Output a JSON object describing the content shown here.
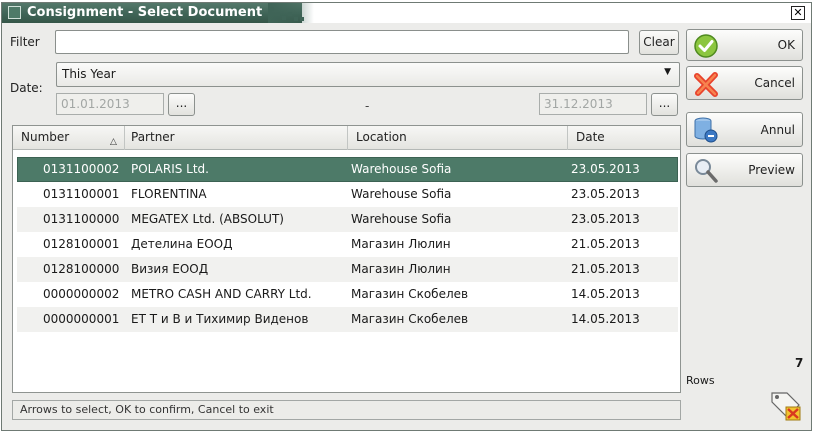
{
  "window": {
    "title": "Consignment - Select Document",
    "close_glyph": "✕"
  },
  "filter": {
    "label": "Filter",
    "value": "",
    "clear_label": "Clear"
  },
  "date": {
    "label": "Date:",
    "period": "This Year",
    "from": "01.01.2013",
    "to": "31.12.2013",
    "separator": "-",
    "picker_label": "..."
  },
  "grid": {
    "columns": [
      "Number",
      "Partner",
      "Location",
      "Date"
    ],
    "sort_indicator": "△",
    "rows": [
      {
        "number": "0131100002",
        "partner": "POLARIS Ltd.",
        "location": "Warehouse Sofia",
        "date": "23.05.2013"
      },
      {
        "number": "0131100001",
        "partner": "FLORENTINA",
        "location": "Warehouse Sofia",
        "date": "23.05.2013"
      },
      {
        "number": "0131100000",
        "partner": "MEGATEX Ltd. (ABSOLUT)",
        "location": "Warehouse Sofia",
        "date": "23.05.2013"
      },
      {
        "number": "0128100001",
        "partner": "Детелина ЕООД",
        "location": "Магазин Люлин",
        "date": "21.05.2013"
      },
      {
        "number": "0128100000",
        "partner": "Визия ЕООД",
        "location": "Магазин Люлин",
        "date": "21.05.2013"
      },
      {
        "number": "0000000002",
        "partner": "METRO CASH AND CARRY Ltd.",
        "location": "Магазин Скобелев",
        "date": "14.05.2013"
      },
      {
        "number": "0000000001",
        "partner": "ЕТ Т и В и Тихимир Виденов",
        "location": "Магазин Скобелев",
        "date": "14.05.2013"
      }
    ]
  },
  "status": {
    "text": "Arrows to select, OK to confirm, Cancel to exit"
  },
  "actions": {
    "ok": "OK",
    "cancel": "Cancel",
    "annul": "Annul",
    "preview": "Preview"
  },
  "summary": {
    "rows_count": "7",
    "rows_label": "Rows"
  },
  "colors": {
    "selection": "#4d7a68",
    "title_bar": "#3f6457"
  }
}
